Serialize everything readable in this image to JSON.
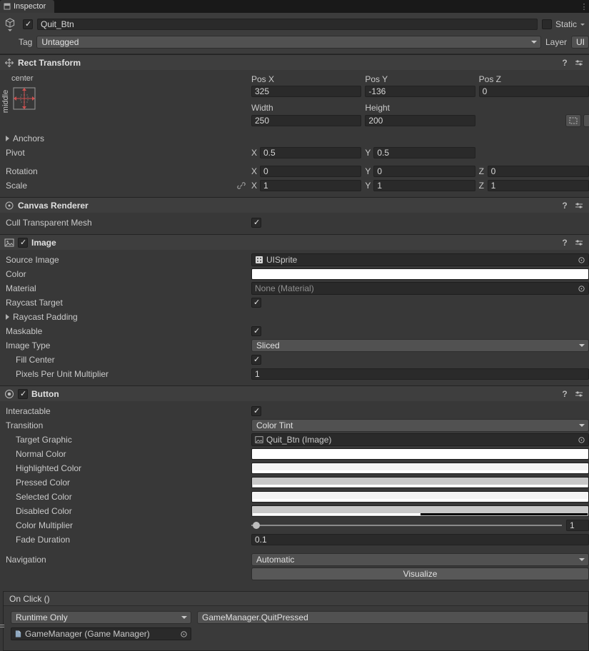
{
  "tab": {
    "title": "Inspector"
  },
  "game_object": {
    "name": "Quit_Btn",
    "static_label": "Static",
    "tag_label": "Tag",
    "tag_value": "Untagged",
    "layer_label": "Layer",
    "layer_value": "UI"
  },
  "rect_transform": {
    "title": "Rect Transform",
    "anchor_top": "center",
    "anchor_side": "middle",
    "pos_x_label": "Pos X",
    "pos_y_label": "Pos Y",
    "pos_z_label": "Pos Z",
    "pos_x": "325",
    "pos_y": "-136",
    "pos_z": "0",
    "width_label": "Width",
    "height_label": "Height",
    "width": "250",
    "height": "200",
    "anchors_label": "Anchors",
    "pivot_label": "Pivot",
    "pivot_x": "0.5",
    "pivot_y": "0.5",
    "rotation_label": "Rotation",
    "rotation_x": "0",
    "rotation_y": "0",
    "rotation_z": "0",
    "scale_label": "Scale",
    "scale_x": "1",
    "scale_y": "1",
    "scale_z": "1",
    "axis_x": "X",
    "axis_y": "Y",
    "axis_z": "Z"
  },
  "canvas_renderer": {
    "title": "Canvas Renderer",
    "cull_transparent_mesh_label": "Cull Transparent Mesh"
  },
  "image": {
    "title": "Image",
    "source_image_label": "Source Image",
    "source_image_value": "UISprite",
    "color_label": "Color",
    "color_value": "#FFFFFF",
    "material_label": "Material",
    "material_value": "None (Material)",
    "raycast_target_label": "Raycast Target",
    "raycast_padding_label": "Raycast Padding",
    "maskable_label": "Maskable",
    "image_type_label": "Image Type",
    "image_type_value": "Sliced",
    "fill_center_label": "Fill Center",
    "pixels_per_unit_label": "Pixels Per Unit Multiplier",
    "pixels_per_unit_value": "1"
  },
  "button": {
    "title": "Button",
    "interactable_label": "Interactable",
    "transition_label": "Transition",
    "transition_value": "Color Tint",
    "target_graphic_label": "Target Graphic",
    "target_graphic_value": "Quit_Btn (Image)",
    "normal_color_label": "Normal Color",
    "highlighted_color_label": "Highlighted Color",
    "pressed_color_label": "Pressed Color",
    "selected_color_label": "Selected Color",
    "disabled_color_label": "Disabled Color",
    "color_multiplier_label": "Color Multiplier",
    "color_multiplier_value": "1",
    "fade_duration_label": "Fade Duration",
    "fade_duration_value": "0.1",
    "navigation_label": "Navigation",
    "navigation_value": "Automatic",
    "visualize_label": "Visualize",
    "swatches": {
      "normal": "#FFFFFF",
      "highlighted": "#F4F4F4",
      "pressed": "#C8C8C8",
      "selected": "#F4F4F4",
      "disabled": "#C8C8C8",
      "disabled_alpha_width": "50%"
    }
  },
  "on_click": {
    "title": "On Click ()",
    "mode_value": "Runtime Only",
    "function_value": "GameManager.QuitPressed",
    "target_value": "GameManager (Game Manager)"
  }
}
